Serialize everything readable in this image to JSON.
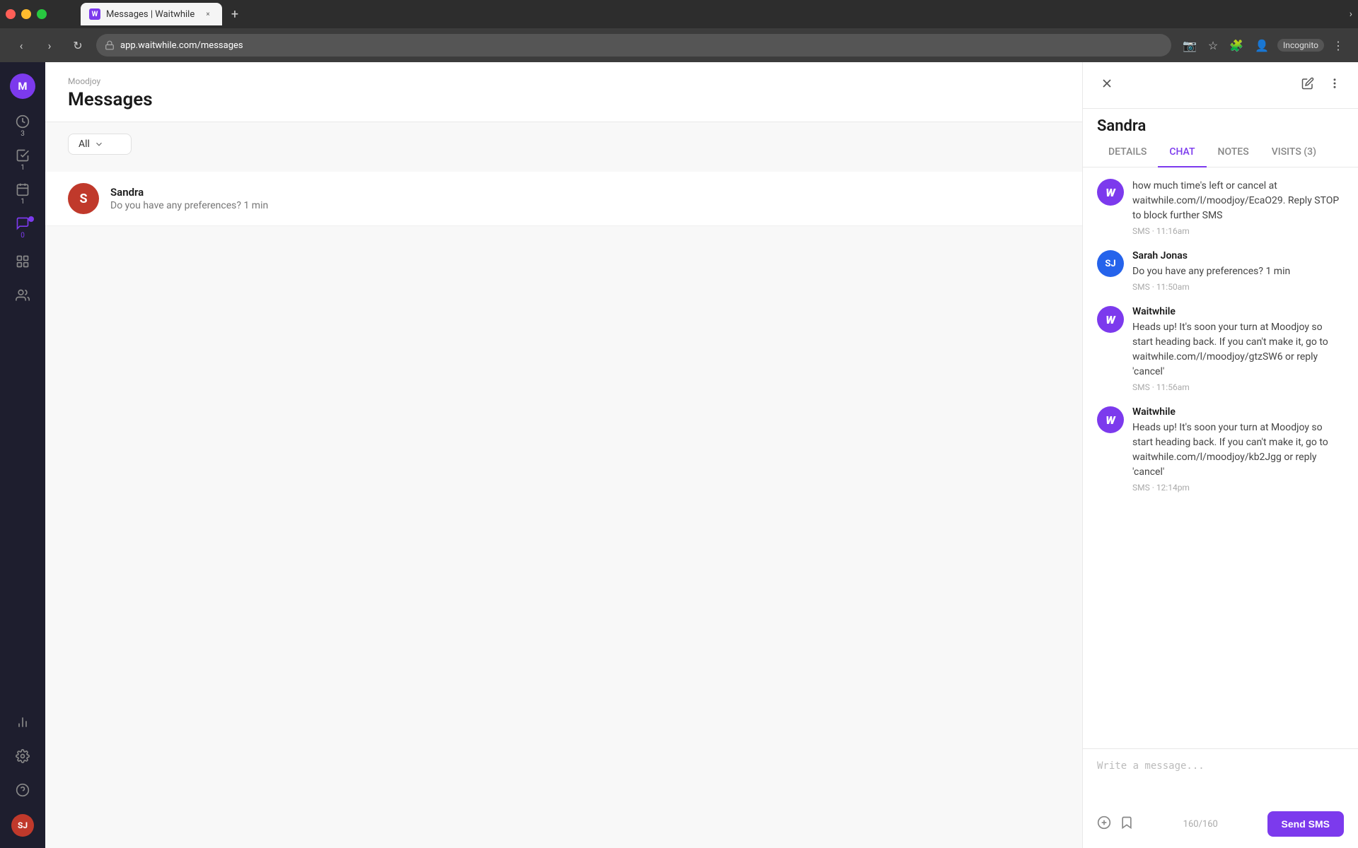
{
  "browser": {
    "tab_title": "Messages | Waitwhile",
    "address": "app.waitwhile.com/messages",
    "incognito_label": "Incognito"
  },
  "app": {
    "org_name": "Moodjoy",
    "page_title": "Messages",
    "org_initial": "M",
    "user_initials": "SJ"
  },
  "sidebar": {
    "items": [
      {
        "id": "dashboard",
        "icon": "chart-circle",
        "badge": "3",
        "badge_highlight": false
      },
      {
        "id": "checklist",
        "icon": "check-square",
        "badge": "1",
        "badge_highlight": false
      },
      {
        "id": "calendar",
        "icon": "calendar",
        "badge": "1",
        "badge_highlight": false
      },
      {
        "id": "messages",
        "icon": "chat",
        "badge": "0",
        "badge_highlight": true
      },
      {
        "id": "group",
        "icon": "group",
        "badge": "",
        "badge_highlight": false
      },
      {
        "id": "people",
        "icon": "people",
        "badge": "",
        "badge_highlight": false
      },
      {
        "id": "analytics",
        "icon": "analytics",
        "badge": "",
        "badge_highlight": false
      },
      {
        "id": "settings",
        "icon": "settings",
        "badge": "",
        "badge_highlight": false
      }
    ]
  },
  "filter": {
    "dropdown_value": "All",
    "dropdown_placeholder": "All"
  },
  "messages_list": [
    {
      "id": "sandra",
      "name": "Sandra",
      "initials": "S",
      "preview": "Do you have any preferences? 1 min",
      "avatar_color": "#c0392b"
    }
  ],
  "right_panel": {
    "contact_name": "Sandra",
    "tabs": [
      {
        "id": "details",
        "label": "DETAILS"
      },
      {
        "id": "chat",
        "label": "CHAT"
      },
      {
        "id": "notes",
        "label": "NOTES"
      },
      {
        "id": "visits",
        "label": "VISITS (3)"
      }
    ],
    "active_tab": "chat",
    "chat_messages": [
      {
        "id": "msg1",
        "sender": null,
        "avatar_type": "waitwhile",
        "avatar_initials": "W",
        "text": "how much time's left or cancel at waitwhile.com/l/moodjoy/EcaO29. Reply STOP to block further SMS",
        "time": "SMS · 11:16am"
      },
      {
        "id": "msg2",
        "sender": "Sarah Jonas",
        "avatar_type": "sarah",
        "avatar_initials": "SJ",
        "text": "Do you have any preferences? 1 min",
        "time": "SMS · 11:50am"
      },
      {
        "id": "msg3",
        "sender": "Waitwhile",
        "avatar_type": "waitwhile",
        "avatar_initials": "W",
        "text": "Heads up! It's soon your turn at Moodjoy so start heading back. If you can't make it, go to waitwhile.com/l/moodjoy/gtzSW6 or reply 'cancel'",
        "time": "SMS · 11:56am"
      },
      {
        "id": "msg4",
        "sender": "Waitwhile",
        "avatar_type": "waitwhile",
        "avatar_initials": "W",
        "text": "Heads up! It's soon your turn at Moodjoy so start heading back. If you can't make it, go to waitwhile.com/l/moodjoy/kb2Jgg or reply 'cancel'",
        "time": "SMS · 12:14pm"
      }
    ],
    "message_input_placeholder": "Write a message...",
    "char_count": "160/160",
    "send_button_label": "Send SMS"
  }
}
